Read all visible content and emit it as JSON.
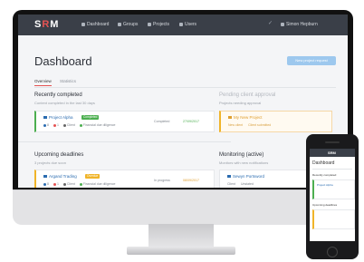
{
  "nav": {
    "logo_text": "S",
    "logo_accent": "R",
    "logo_tail": "M",
    "items": [
      {
        "label": "Dashboard",
        "icon": "dashboard-icon"
      },
      {
        "label": "Groups",
        "icon": "groups-icon"
      },
      {
        "label": "Projects",
        "icon": "folder-icon"
      },
      {
        "label": "Users",
        "icon": "user-icon"
      }
    ],
    "user_label": "Simon Hepburn"
  },
  "page": {
    "title": "Dashboard",
    "primary_button": "New project request",
    "tabs": [
      "Overview",
      "Statistics"
    ]
  },
  "recently_completed": {
    "title": "Recently completed",
    "subtitle": "Content completed in the last 30 days",
    "card": {
      "project": "Project Alpha",
      "badge": "Completed",
      "meta_1": "8",
      "meta_2": "1",
      "meta_3": "Client",
      "meta_4": "Financial due diligence",
      "status": "Completed",
      "date": "27/09/2017"
    }
  },
  "pending": {
    "title": "Pending client approval",
    "subtitle": "Projects needing approval",
    "card": {
      "project": "My New Project",
      "meta_1": "New client",
      "meta_2": "Client submitted"
    }
  },
  "upcoming": {
    "title": "Upcoming deadlines",
    "subtitle": "3 projects due soon",
    "card": {
      "project": "Argand Trading",
      "badge": "Overdue",
      "meta_1": "8",
      "meta_2": "1",
      "meta_3": "Client",
      "meta_4": "Financial due diligence",
      "status": "In progress",
      "date": "08/09/2017"
    }
  },
  "monitoring": {
    "title": "Monitoring (active)",
    "subtitle": "Monitors with new notifications",
    "card": {
      "project": "Sewyn Portsword",
      "meta_1": "Client",
      "meta_2": "Unstated"
    }
  },
  "phone": {
    "logo": "SRM",
    "heading": "Dashboard",
    "section": "Recently completed",
    "card_title": "Project Alpha",
    "card2_title": "Upcoming deadlines"
  },
  "colors": {
    "accent": "#e55353",
    "nav": "#3a3f48",
    "link": "#2b6cb0",
    "button": "#9dc8ee"
  }
}
